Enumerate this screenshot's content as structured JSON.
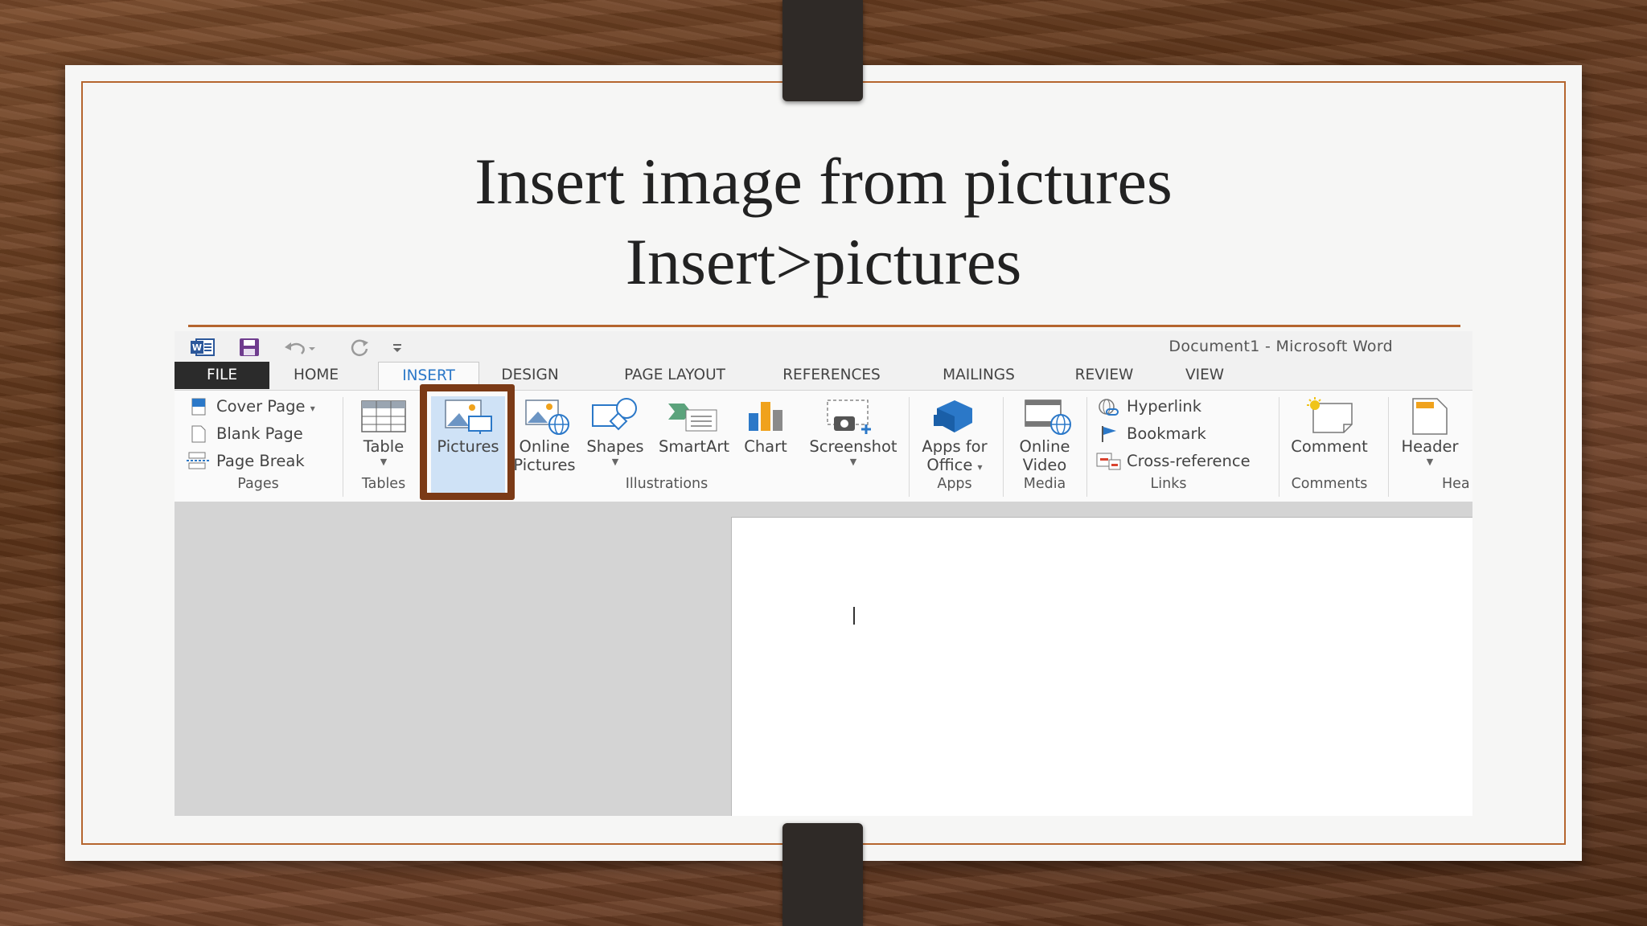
{
  "slide": {
    "title_line1": "Insert image from pictures",
    "title_line2": "Insert>pictures",
    "accent_color": "#b5652e",
    "highlight_color": "#7b3a16"
  },
  "word": {
    "window_title": "Document1 - Microsoft Word",
    "quick_access_icons": [
      "word-icon",
      "save-icon",
      "undo-icon",
      "redo-icon",
      "customize-qat-icon"
    ],
    "tabs": [
      "FILE",
      "HOME",
      "INSERT",
      "DESIGN",
      "PAGE LAYOUT",
      "REFERENCES",
      "MAILINGS",
      "REVIEW",
      "VIEW"
    ],
    "active_tab": "INSERT",
    "ribbon": {
      "pages": {
        "group": "Pages",
        "items": [
          "Cover Page",
          "Blank Page",
          "Page Break"
        ]
      },
      "tables": {
        "group": "Tables",
        "table": "Table"
      },
      "illustrations": {
        "group": "Illustrations",
        "pictures": "Pictures",
        "online_pictures_l1": "Online",
        "online_pictures_l2": "Pictures",
        "shapes": "Shapes",
        "smartart": "SmartArt",
        "chart": "Chart",
        "screenshot": "Screenshot"
      },
      "apps": {
        "group": "Apps",
        "apps_l1": "Apps for",
        "apps_l2": "Office"
      },
      "media": {
        "group": "Media",
        "video_l1": "Online",
        "video_l2": "Video"
      },
      "links": {
        "group": "Links",
        "items": [
          "Hyperlink",
          "Bookmark",
          "Cross-reference"
        ]
      },
      "comments": {
        "group": "Comments",
        "comment": "Comment"
      },
      "header_footer": {
        "group": "Hea",
        "header": "Header"
      }
    },
    "highlighted_command": "Pictures"
  }
}
